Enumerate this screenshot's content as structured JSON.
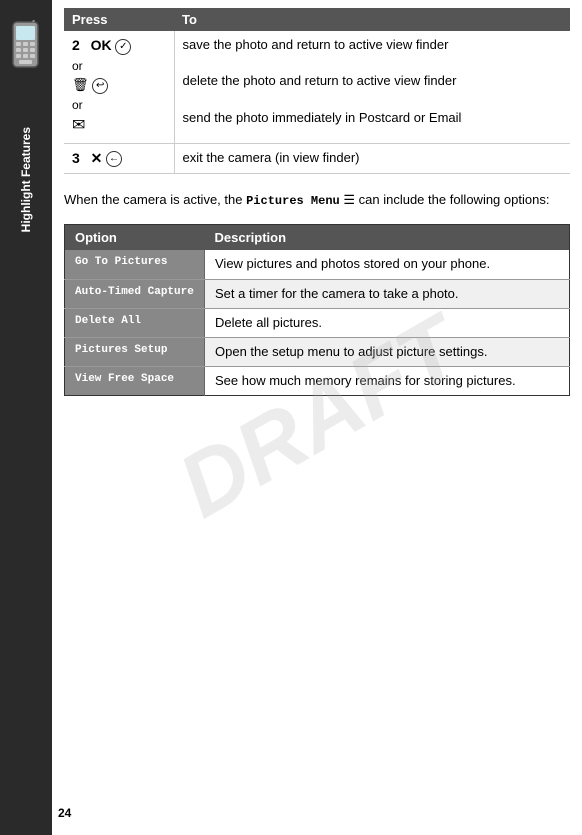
{
  "sidebar": {
    "label": "Highlight Features",
    "background": "#2a2a2a"
  },
  "page_number": "24",
  "draft_text": "DRAFT",
  "header": {
    "col1": "Press",
    "col2": "To"
  },
  "instruction_rows": [
    {
      "step": "2",
      "press_html": "OK_row",
      "to": "save the photo and return to active view finder"
    },
    {
      "step": "",
      "press_html": "trash_row",
      "to": "delete the photo and return to active view finder"
    },
    {
      "step": "",
      "press_html": "email_row",
      "to": "send the photo immediately in Postcard or Email"
    },
    {
      "step": "3",
      "press_html": "back_row",
      "to": "exit the camera (in view finder)"
    }
  ],
  "intro_text": "When the camera is active, the",
  "menu_label": "Pictures Menu",
  "intro_text2": "can include the following options:",
  "options_header": {
    "col1": "Option",
    "col2": "Description"
  },
  "options": [
    {
      "option": "Go To Pictures",
      "description": "View pictures and photos stored on your phone."
    },
    {
      "option": "Auto-Timed Capture",
      "description": "Set a timer for the camera to take a photo."
    },
    {
      "option": "Delete All",
      "description": "Delete all pictures."
    },
    {
      "option": "Pictures Setup",
      "description": "Open the setup menu to adjust picture settings."
    },
    {
      "option": "View Free Space",
      "description": "See how much memory remains for storing pictures."
    }
  ]
}
